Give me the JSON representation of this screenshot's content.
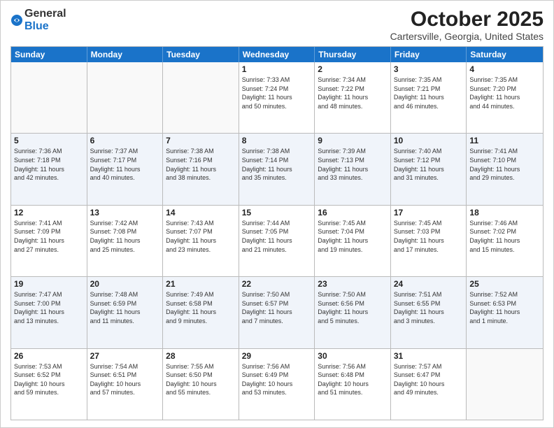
{
  "logo": {
    "text_general": "General",
    "text_blue": "Blue"
  },
  "header": {
    "month": "October 2025",
    "location": "Cartersville, Georgia, United States"
  },
  "weekdays": [
    "Sunday",
    "Monday",
    "Tuesday",
    "Wednesday",
    "Thursday",
    "Friday",
    "Saturday"
  ],
  "weeks": [
    [
      {
        "num": "",
        "info": ""
      },
      {
        "num": "",
        "info": ""
      },
      {
        "num": "",
        "info": ""
      },
      {
        "num": "1",
        "info": "Sunrise: 7:33 AM\nSunset: 7:24 PM\nDaylight: 11 hours\nand 50 minutes."
      },
      {
        "num": "2",
        "info": "Sunrise: 7:34 AM\nSunset: 7:22 PM\nDaylight: 11 hours\nand 48 minutes."
      },
      {
        "num": "3",
        "info": "Sunrise: 7:35 AM\nSunset: 7:21 PM\nDaylight: 11 hours\nand 46 minutes."
      },
      {
        "num": "4",
        "info": "Sunrise: 7:35 AM\nSunset: 7:20 PM\nDaylight: 11 hours\nand 44 minutes."
      }
    ],
    [
      {
        "num": "5",
        "info": "Sunrise: 7:36 AM\nSunset: 7:18 PM\nDaylight: 11 hours\nand 42 minutes."
      },
      {
        "num": "6",
        "info": "Sunrise: 7:37 AM\nSunset: 7:17 PM\nDaylight: 11 hours\nand 40 minutes."
      },
      {
        "num": "7",
        "info": "Sunrise: 7:38 AM\nSunset: 7:16 PM\nDaylight: 11 hours\nand 38 minutes."
      },
      {
        "num": "8",
        "info": "Sunrise: 7:38 AM\nSunset: 7:14 PM\nDaylight: 11 hours\nand 35 minutes."
      },
      {
        "num": "9",
        "info": "Sunrise: 7:39 AM\nSunset: 7:13 PM\nDaylight: 11 hours\nand 33 minutes."
      },
      {
        "num": "10",
        "info": "Sunrise: 7:40 AM\nSunset: 7:12 PM\nDaylight: 11 hours\nand 31 minutes."
      },
      {
        "num": "11",
        "info": "Sunrise: 7:41 AM\nSunset: 7:10 PM\nDaylight: 11 hours\nand 29 minutes."
      }
    ],
    [
      {
        "num": "12",
        "info": "Sunrise: 7:41 AM\nSunset: 7:09 PM\nDaylight: 11 hours\nand 27 minutes."
      },
      {
        "num": "13",
        "info": "Sunrise: 7:42 AM\nSunset: 7:08 PM\nDaylight: 11 hours\nand 25 minutes."
      },
      {
        "num": "14",
        "info": "Sunrise: 7:43 AM\nSunset: 7:07 PM\nDaylight: 11 hours\nand 23 minutes."
      },
      {
        "num": "15",
        "info": "Sunrise: 7:44 AM\nSunset: 7:05 PM\nDaylight: 11 hours\nand 21 minutes."
      },
      {
        "num": "16",
        "info": "Sunrise: 7:45 AM\nSunset: 7:04 PM\nDaylight: 11 hours\nand 19 minutes."
      },
      {
        "num": "17",
        "info": "Sunrise: 7:45 AM\nSunset: 7:03 PM\nDaylight: 11 hours\nand 17 minutes."
      },
      {
        "num": "18",
        "info": "Sunrise: 7:46 AM\nSunset: 7:02 PM\nDaylight: 11 hours\nand 15 minutes."
      }
    ],
    [
      {
        "num": "19",
        "info": "Sunrise: 7:47 AM\nSunset: 7:00 PM\nDaylight: 11 hours\nand 13 minutes."
      },
      {
        "num": "20",
        "info": "Sunrise: 7:48 AM\nSunset: 6:59 PM\nDaylight: 11 hours\nand 11 minutes."
      },
      {
        "num": "21",
        "info": "Sunrise: 7:49 AM\nSunset: 6:58 PM\nDaylight: 11 hours\nand 9 minutes."
      },
      {
        "num": "22",
        "info": "Sunrise: 7:50 AM\nSunset: 6:57 PM\nDaylight: 11 hours\nand 7 minutes."
      },
      {
        "num": "23",
        "info": "Sunrise: 7:50 AM\nSunset: 6:56 PM\nDaylight: 11 hours\nand 5 minutes."
      },
      {
        "num": "24",
        "info": "Sunrise: 7:51 AM\nSunset: 6:55 PM\nDaylight: 11 hours\nand 3 minutes."
      },
      {
        "num": "25",
        "info": "Sunrise: 7:52 AM\nSunset: 6:53 PM\nDaylight: 11 hours\nand 1 minute."
      }
    ],
    [
      {
        "num": "26",
        "info": "Sunrise: 7:53 AM\nSunset: 6:52 PM\nDaylight: 10 hours\nand 59 minutes."
      },
      {
        "num": "27",
        "info": "Sunrise: 7:54 AM\nSunset: 6:51 PM\nDaylight: 10 hours\nand 57 minutes."
      },
      {
        "num": "28",
        "info": "Sunrise: 7:55 AM\nSunset: 6:50 PM\nDaylight: 10 hours\nand 55 minutes."
      },
      {
        "num": "29",
        "info": "Sunrise: 7:56 AM\nSunset: 6:49 PM\nDaylight: 10 hours\nand 53 minutes."
      },
      {
        "num": "30",
        "info": "Sunrise: 7:56 AM\nSunset: 6:48 PM\nDaylight: 10 hours\nand 51 minutes."
      },
      {
        "num": "31",
        "info": "Sunrise: 7:57 AM\nSunset: 6:47 PM\nDaylight: 10 hours\nand 49 minutes."
      },
      {
        "num": "",
        "info": ""
      }
    ]
  ]
}
